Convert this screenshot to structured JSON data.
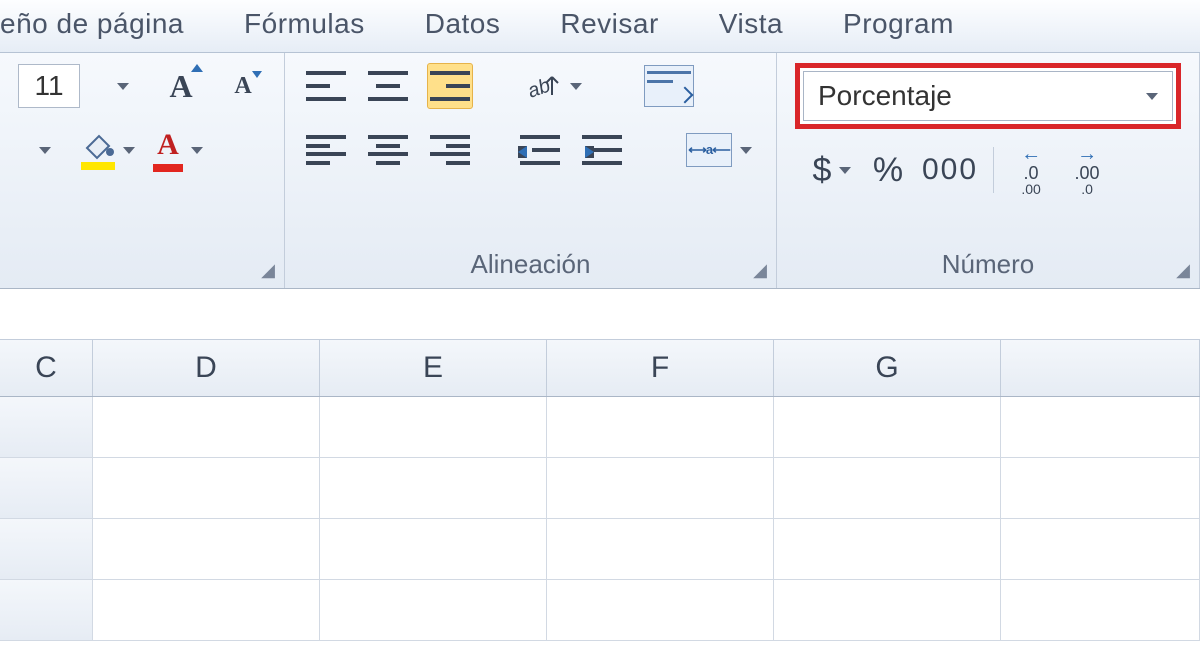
{
  "tabs": {
    "diseno": "eño de página",
    "formulas": "Fórmulas",
    "datos": "Datos",
    "revisar": "Revisar",
    "vista": "Vista",
    "programador": "Program"
  },
  "font": {
    "size": "11"
  },
  "groups": {
    "alineacion": "Alineación",
    "numero": "Número"
  },
  "number_format": {
    "selected": "Porcentaje",
    "currency_symbol": "$",
    "percent_symbol": "%",
    "thousands": "000"
  },
  "columns": [
    "C",
    "D",
    "E",
    "F",
    "G"
  ]
}
